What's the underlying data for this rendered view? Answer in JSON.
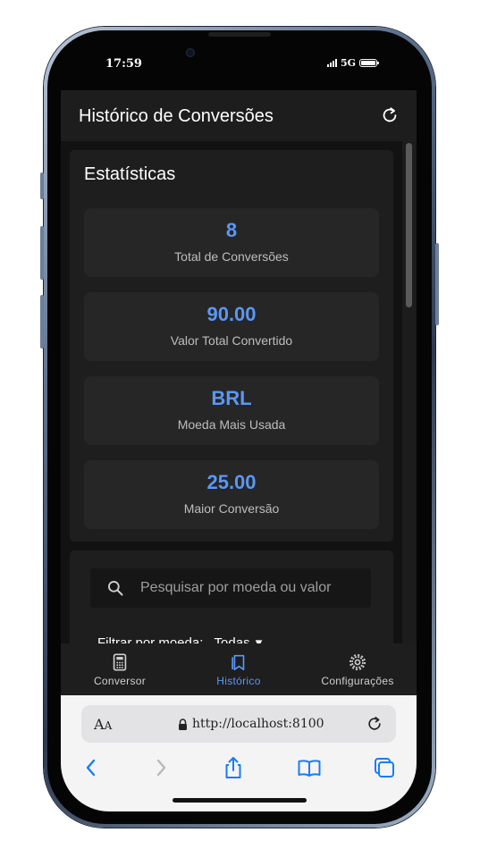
{
  "status_bar": {
    "time": "17:59",
    "network": "5G"
  },
  "header": {
    "title": "Histórico de Conversões",
    "refresh_icon": "refresh-icon"
  },
  "stats": {
    "title": "Estatísticas",
    "items": [
      {
        "value": "8",
        "label": "Total de Conversões"
      },
      {
        "value": "90.00",
        "label": "Valor Total Convertido"
      },
      {
        "value": "BRL",
        "label": "Moeda Mais Usada"
      },
      {
        "value": "25.00",
        "label": "Maior Conversão"
      }
    ]
  },
  "search": {
    "placeholder": "Pesquisar por moeda ou valor",
    "value": ""
  },
  "filter": {
    "label": "Filtrar por moeda:",
    "selected": "Todas"
  },
  "nav": {
    "items": [
      {
        "label": "Conversor",
        "icon": "calculator-icon",
        "active": false
      },
      {
        "label": "Histórico",
        "icon": "bookmark-icon",
        "active": true
      },
      {
        "label": "Configurações",
        "icon": "gear-icon",
        "active": false
      }
    ]
  },
  "browser": {
    "aa_label": "AA",
    "url": "http://localhost:8100"
  },
  "colors": {
    "accent": "#5b97f5",
    "background": "#121212",
    "card": "#1e1e1e",
    "stat_card": "#262626",
    "safari_blue": "#1a7cf5"
  }
}
